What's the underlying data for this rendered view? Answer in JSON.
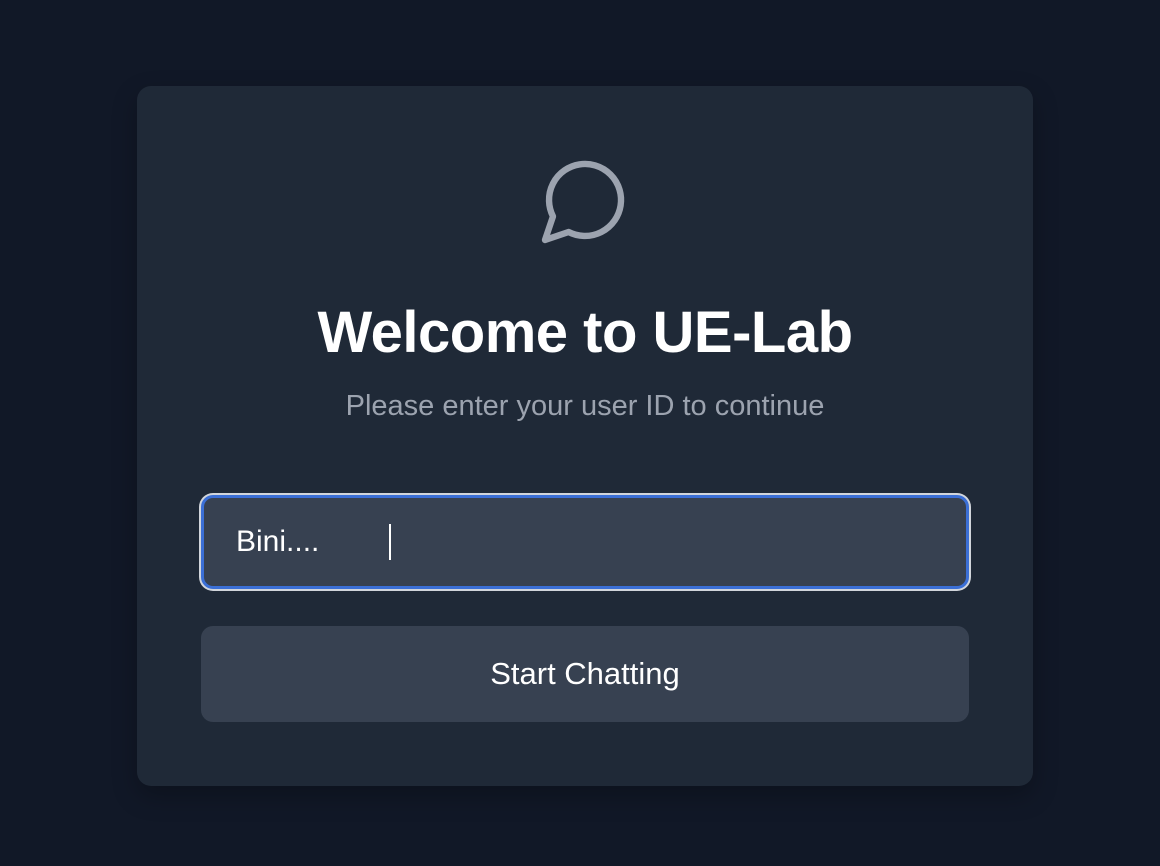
{
  "login": {
    "icon": "chat-bubble-icon",
    "title": "Welcome to UE-Lab",
    "subtitle": "Please enter your user ID to continue",
    "user_id_value": "Bini....",
    "submit_label": "Start Chatting"
  },
  "colors": {
    "background": "#111827",
    "card": "#1f2937",
    "input_bg": "#374151",
    "focus_ring": "#3b6fd6",
    "icon": "#9ca3af",
    "subtitle": "#9ca3af",
    "text": "#ffffff"
  }
}
